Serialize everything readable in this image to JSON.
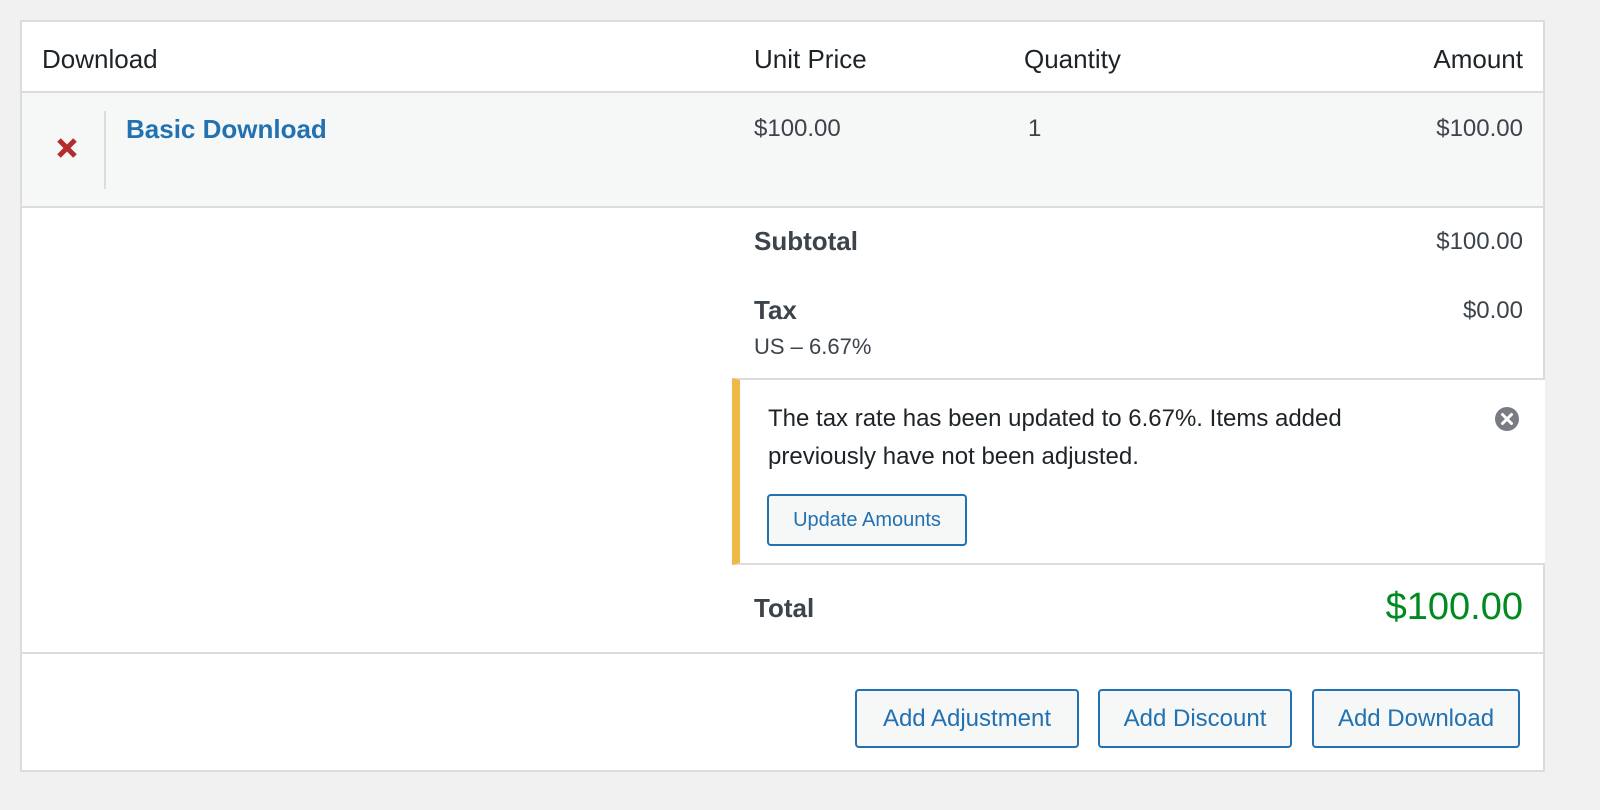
{
  "table": {
    "headers": {
      "download": "Download",
      "unit_price": "Unit Price",
      "quantity": "Quantity",
      "amount": "Amount"
    },
    "items": [
      {
        "name": "Basic Download",
        "unit_price": "$100.00",
        "quantity": "1",
        "amount": "$100.00",
        "remove_icon": "close-x-icon"
      }
    ]
  },
  "summary": {
    "subtotal_label": "Subtotal",
    "subtotal_value": "$100.00",
    "tax_label": "Tax",
    "tax_rate": "US – 6.67%",
    "tax_value": "$0.00",
    "total_label": "Total",
    "total_value": "$100.00"
  },
  "notice": {
    "text": "The tax rate has been updated to 6.67%. Items added previously have not been adjusted.",
    "button_label": "Update Amounts",
    "dismiss_icon": "dismiss-circle-icon"
  },
  "actions": {
    "add_adjustment": "Add Adjustment",
    "add_discount": "Add Discount",
    "add_download": "Add Download"
  },
  "colors": {
    "link": "#2271b1",
    "remove": "#b32d2e",
    "total": "#008a20",
    "notice_accent": "#f0b849"
  }
}
